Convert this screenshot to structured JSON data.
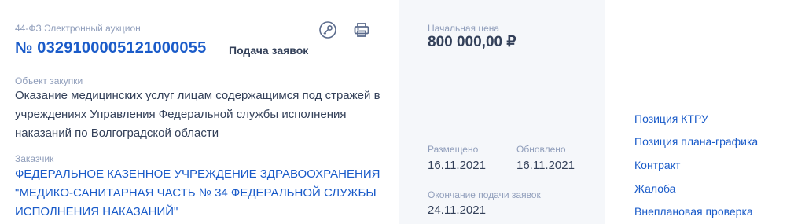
{
  "procurement": {
    "law_type": "44-ФЗ Электронный аукцион",
    "number": "№ 0329100005121000055",
    "status": "Подача заявок",
    "object_label": "Объект закупки",
    "object_text": "Оказание медицинских услуг лицам содержащимся под стражей в учреждениях Управления Федеральной службы исполнения наказаний по Волгоградской области",
    "customer_label": "Заказчик",
    "customer_name": "ФЕДЕРАЛЬНОЕ КАЗЕННОЕ УЧРЕЖДЕНИЕ ЗДРАВООХРАНЕНИЯ \"МЕДИКО-САНИТАРНАЯ ЧАСТЬ № 34 ФЕДЕРАЛЬНОЙ СЛУЖБЫ ИСПОЛНЕНИЯ НАКАЗАНИЙ\""
  },
  "price": {
    "label": "Начальная цена",
    "value": "800 000,00 ₽"
  },
  "dates": {
    "posted_label": "Размещено",
    "posted_value": "16.11.2021",
    "updated_label": "Обновлено",
    "updated_value": "16.11.2021",
    "deadline_label": "Окончание подачи заявок",
    "deadline_value": "24.11.2021"
  },
  "links": [
    {
      "label": "Позиция КТРУ"
    },
    {
      "label": "Позиция плана-графика"
    },
    {
      "label": "Контракт"
    },
    {
      "label": "Жалоба"
    },
    {
      "label": "Внеплановая проверка"
    }
  ],
  "icons": {
    "key": "key-icon",
    "print": "print-icon"
  },
  "colors": {
    "link": "#1a5bc9",
    "text": "#334059",
    "muted": "#909ebb",
    "panel_bg": "#f5f7fa",
    "icon": "#5b6b8c"
  }
}
